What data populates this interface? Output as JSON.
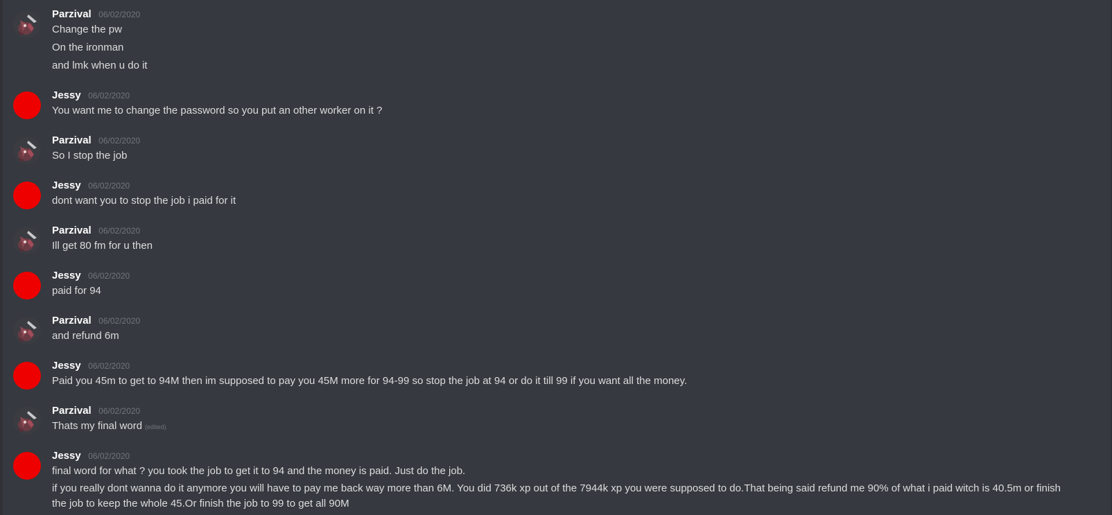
{
  "messages": [
    {
      "author": "Parzival",
      "timestamp": "06/02/2020",
      "avatar": "parzival-avatar",
      "lines": [
        "Change the pw",
        "On the ironman",
        "and lmk when u do it"
      ]
    },
    {
      "author": "Jessy",
      "timestamp": "06/02/2020",
      "avatar": "jessy-avatar",
      "lines": [
        "You want me to change the password so you put an other worker on it ?"
      ]
    },
    {
      "author": "Parzival",
      "timestamp": "06/02/2020",
      "avatar": "parzival-avatar",
      "lines": [
        "So I stop the job"
      ]
    },
    {
      "author": "Jessy",
      "timestamp": "06/02/2020",
      "avatar": "jessy-avatar",
      "lines": [
        "dont want you to stop the job i paid for it"
      ]
    },
    {
      "author": "Parzival",
      "timestamp": "06/02/2020",
      "avatar": "parzival-avatar",
      "lines": [
        "Ill get 80 fm for u then"
      ]
    },
    {
      "author": "Jessy",
      "timestamp": "06/02/2020",
      "avatar": "jessy-avatar",
      "lines": [
        "paid for 94"
      ]
    },
    {
      "author": "Parzival",
      "timestamp": "06/02/2020",
      "avatar": "parzival-avatar",
      "lines": [
        "and refund 6m"
      ]
    },
    {
      "author": "Jessy",
      "timestamp": "06/02/2020",
      "avatar": "jessy-avatar",
      "lines": [
        "Paid you 45m to get to 94M then im supposed to pay you 45M more for 94-99 so stop the job at 94 or do it till 99 if you want all the money."
      ]
    },
    {
      "author": "Parzival",
      "timestamp": "06/02/2020",
      "avatar": "parzival-avatar",
      "lines": [
        "Thats my final word"
      ],
      "edited": "(edited)"
    },
    {
      "author": "Jessy",
      "timestamp": "06/02/2020",
      "avatar": "jessy-avatar",
      "lines": [
        "final word for what ? you took the job to get it to 94 and the money is paid. Just do the job.",
        "if you really dont wanna do it anymore you will have to pay me back way more than 6M. You did 736k xp out of the 7944k xp you were supposed to do.That being said refund me 90% of what i paid witch is 40.5m or finish the job to keep the whole 45.Or finish the job to 99 to get all 90M"
      ]
    }
  ],
  "colors": {
    "background": "#36393f",
    "author": "#ffffff",
    "text": "#dcddde",
    "timestamp": "#72767d",
    "jessy_avatar": "#ee0000"
  }
}
